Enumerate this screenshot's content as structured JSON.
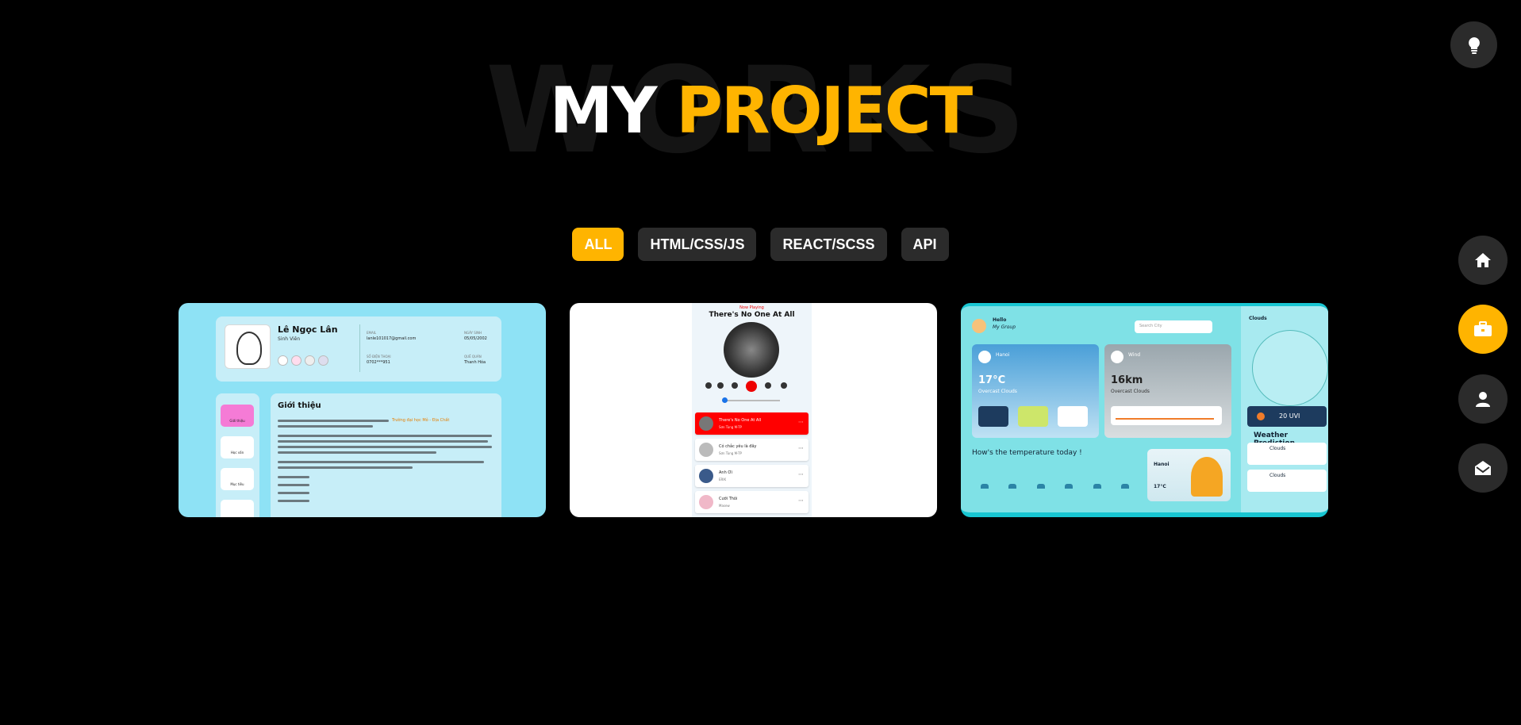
{
  "heading": {
    "background_word": "WORKS",
    "title_part1": "MY",
    "title_part2": "PROJECT"
  },
  "filters": [
    {
      "label": "ALL",
      "active": true
    },
    {
      "label": "HTML/CSS/JS",
      "active": false
    },
    {
      "label": "REACT/SCSS",
      "active": false
    },
    {
      "label": "API",
      "active": false
    }
  ],
  "projects": {
    "profile": {
      "name": "Lê Ngọc Lân",
      "role": "Sinh Viên",
      "email_label": "EMAIL",
      "email": "lanle101017@gmail.com",
      "birth_label": "NGÀY SINH",
      "birth": "05/05/2002",
      "phone_label": "SỐ ĐIỆN THOẠI",
      "phone": "0702***951",
      "hometown_label": "QUÊ QUÁN",
      "hometown": "Thanh Hóa",
      "section_title": "Giới thiệu",
      "intro_highlight": "Trường đại học Mỏ - Địa Chất",
      "nav": [
        "Giới thiệu",
        "Học vấn",
        "Mục tiêu"
      ]
    },
    "music": {
      "now_playing": "Now Playing",
      "song": "There's No One At All",
      "playlist": [
        {
          "title": "There's No One At All",
          "artist": "Sơn Tùng M-TP"
        },
        {
          "title": "Có chắc yêu là đây",
          "artist": "Sơn Tùng M-TP"
        },
        {
          "title": "Anh Ơi",
          "artist": "ERIK"
        },
        {
          "title": "Cưới Thôi",
          "artist": "Masew"
        }
      ]
    },
    "weather": {
      "greeting": "Hello",
      "sub_greeting": "My Group",
      "search_placeholder": "Search City",
      "city": "Hanoi",
      "temp": "17°C",
      "condition": "Overcast Clouds",
      "wind_label": "Wind",
      "wind": "16km",
      "forecast_title": "How's the temperature today !",
      "side_title": "Clouds",
      "uvi": "20 UVI",
      "prediction_title": "Weather Prediction",
      "prediction": [
        "Clouds",
        "Clouds"
      ],
      "hourly_temp": "17°C"
    }
  },
  "icons": {
    "theme_toggle": "lightbulb-icon",
    "home": "home-icon",
    "portfolio": "briefcase-icon",
    "about": "user-icon",
    "contact": "envelope-open-icon"
  },
  "colors": {
    "accent": "#ffb400",
    "background": "#000000",
    "button_bg": "#2b2b2b"
  }
}
